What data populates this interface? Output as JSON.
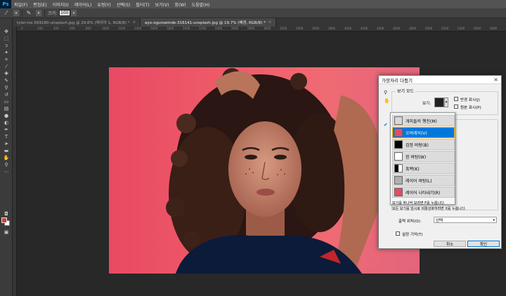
{
  "app": {
    "logo": "Ps",
    "menu": [
      "파일(F)",
      "편집(E)",
      "이미지(I)",
      "레이어(L)",
      "유형(Y)",
      "선택(S)",
      "필터(T)",
      "보기(V)",
      "창(W)",
      "도움말(H)"
    ]
  },
  "options": {
    "size_label": "크기:",
    "size_value": "100"
  },
  "tabs": [
    {
      "label": "tyler-nix-569180-unsplash.jpg @ 29.6% (레이어 1, RGB/8) *"
    },
    {
      "label": "ayo-ogunseinde-316141-unsplash.jpg @ 19.7% (배경, RGB/8) *"
    }
  ],
  "ruler": {
    "ticks": [
      "0",
      "200",
      "400",
      "600",
      "800",
      "1000",
      "1200",
      "1400",
      "1600",
      "1800",
      "2000",
      "2200",
      "2400",
      "2600",
      "2800",
      "3000",
      "3200",
      "3400",
      "3600",
      "3800",
      "4000",
      "4200",
      "4400",
      "4600",
      "4800",
      "5000",
      "5200",
      "5400",
      "5600",
      "5800"
    ]
  },
  "dialog": {
    "title": "가장자리 다듬기",
    "view_mode_label": "보기 모드",
    "view_label": "보기:",
    "show_radius": "반경 표시(J)",
    "show_original": "원본 표시(P)",
    "hint_line1": "보기를 하나씩 보려면 F를 누릅니다.",
    "hint_line2": "모든 보기를 임시로 비활성화하려면 X를 누릅니다.",
    "output_label": "출력 위치(O):",
    "output_value": "선택",
    "remember_label": "설정 기억(T)",
    "cancel_label": "취소",
    "ok_label": "확인"
  },
  "view_modes": [
    {
      "label": "개미들의 행진(M)",
      "selected": false,
      "bg": "#d8d8d8"
    },
    {
      "label": "오버레이(V)",
      "selected": true,
      "bg": "#e84a63"
    },
    {
      "label": "검정 바탕(B)",
      "selected": false,
      "bg": "#000000"
    },
    {
      "label": "흰 바탕(W)",
      "selected": false,
      "bg": "#ffffff"
    },
    {
      "label": "흑백(K)",
      "selected": false,
      "bg": "#ffffff"
    },
    {
      "label": "레이어 바탕(L)",
      "selected": false,
      "bg": "#b0b0b0"
    },
    {
      "label": "레이어 나타내기(R)",
      "selected": false,
      "bg": "#e84a63"
    }
  ],
  "colors": {
    "foreground": "#c5463a",
    "background": "#ffffff",
    "photo_bg": "#ee5a68",
    "accent": "#0078d7"
  }
}
